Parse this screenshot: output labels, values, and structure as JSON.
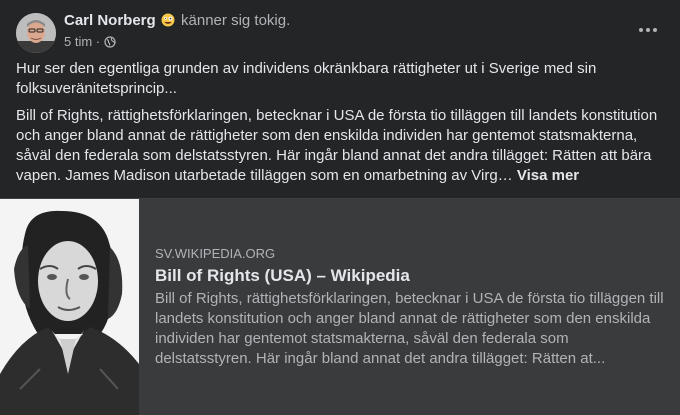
{
  "post": {
    "author": "Carl Norberg",
    "feeling": "känner sig tokig.",
    "time": "5 tim",
    "time_separator": "·",
    "text_paragraph_1": "Hur ser den egentliga grunden av individens okränkbara rättigheter ut i Sverige med sin folksuveränitetsprincip...",
    "text_paragraph_2": "Bill of Rights, rättighetsförklaringen, betecknar i USA de första tio tilläggen till landets konstitution och anger bland annat de rättigheter som den enskilda individen har gentemot statsmakterna, såväl den federala som delstatsstyren. Här ingår bland annat det andra tillägget: Rätten att bära vapen. James Madison utarbetade tilläggen som en omarbetning av Virg…",
    "see_more": "Visa mer"
  },
  "link_preview": {
    "domain": "SV.WIKIPEDIA.ORG",
    "title": "Bill of Rights (USA) – Wikipedia",
    "description": "Bill of Rights, rättighetsförklaringen, betecknar i USA de första tio tilläggen till landets konstitution och anger bland annat de rättigheter som den enskilda individen har gentemot statsmakterna, såväl den federala som delstatsstyren. Här ingår bland annat det andra tillägget: Rätten at..."
  },
  "icons": {
    "feeling": "crazy-face-emoji",
    "privacy": "globe-icon",
    "menu": "more-options-icon"
  },
  "colors": {
    "background": "#242526",
    "card": "#3a3b3c",
    "primary_text": "#e4e6eb",
    "secondary_text": "#b0b3b8"
  }
}
